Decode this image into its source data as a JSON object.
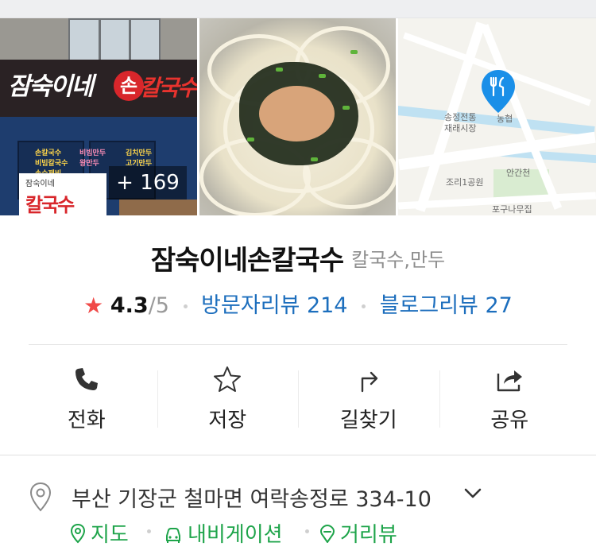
{
  "photos": {
    "more_count": "+ 169",
    "storefront_sign": "잠숙이네",
    "storefront_sign_hand": "손",
    "storefront_sign_2": "칼국수",
    "banner_small": "잠숙이네",
    "banner_big": "칼국수",
    "window_menu_1": [
      "손칼국수",
      "비빔칼국수",
      "손수제비"
    ],
    "window_menu_2": [
      "비빔만두",
      "왕만두"
    ],
    "window_menu_3": [
      "김치만두",
      "고기만두"
    ],
    "map_labels": {
      "market": "송정전통\n재래시장",
      "bank": "농협",
      "stream": "안간천",
      "park": "조리1공원",
      "restaurant": "포구나무집"
    }
  },
  "place": {
    "name": "잠숙이네손칼국수",
    "category": "칼국수,만두",
    "rating": "4.3",
    "rating_max": "/5",
    "visitor_reviews": "방문자리뷰 214",
    "blog_reviews": "블로그리뷰 27"
  },
  "actions": [
    {
      "label": "전화",
      "icon": "phone-icon"
    },
    {
      "label": "저장",
      "icon": "star-outline-icon"
    },
    {
      "label": "길찾기",
      "icon": "directions-icon"
    },
    {
      "label": "공유",
      "icon": "share-icon"
    }
  ],
  "address": {
    "text": "부산 기장군 철마면 여락송정로 334-10",
    "links": {
      "map": "지도",
      "navigation": "내비게이션",
      "street_view": "거리뷰"
    }
  },
  "colors": {
    "star": "#f04a48",
    "link_blue": "#1c6ebd",
    "link_green": "#1ea44a",
    "map_pin": "#1a8fe8"
  }
}
